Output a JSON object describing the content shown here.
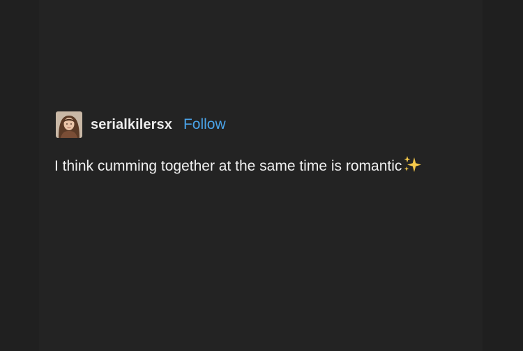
{
  "post": {
    "username": "serialkilersx",
    "follow_label": "Follow",
    "text": "I think cumming together at the same time is romantic",
    "emoji_icon": "sparkles-icon"
  },
  "colors": {
    "background": "#232323",
    "text": "#f0f0f0",
    "follow": "#4aa3e8"
  }
}
